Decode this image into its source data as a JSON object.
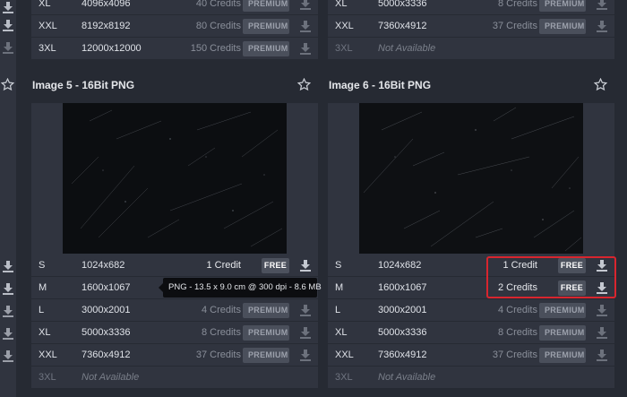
{
  "left_strip": {
    "icon": "download-icon"
  },
  "image5": {
    "title": "Image 5 - 16Bit PNG",
    "top_rows": [
      {
        "size": "XL",
        "dim": "4096x4096",
        "credits": "40 Credits",
        "badge": "PREMIUM"
      },
      {
        "size": "XXL",
        "dim": "8192x8192",
        "credits": "80 Credits",
        "badge": "PREMIUM"
      },
      {
        "size": "3XL",
        "dim": "12000x12000",
        "credits": "150 Credits",
        "badge": "PREMIUM"
      }
    ],
    "rows": [
      {
        "size": "S",
        "dim": "1024x682",
        "credits": "1 Credit",
        "badge": "FREE"
      },
      {
        "size": "M",
        "dim": "1600x1067",
        "credits": "",
        "badge": ""
      },
      {
        "size": "L",
        "dim": "3000x2001",
        "credits": "4 Credits",
        "badge": "PREMIUM"
      },
      {
        "size": "XL",
        "dim": "5000x3336",
        "credits": "8 Credits",
        "badge": "PREMIUM"
      },
      {
        "size": "XXL",
        "dim": "7360x4912",
        "credits": "37 Credits",
        "badge": "PREMIUM"
      },
      {
        "size": "3XL",
        "dim": "Not Available",
        "credits": "",
        "badge": ""
      }
    ],
    "tooltip": "PNG - 13.5 x 9.0 cm @ 300 dpi - 8.6 MB"
  },
  "image6": {
    "title": "Image 6 - 16Bit PNG",
    "top_rows": [
      {
        "size": "XL",
        "dim": "5000x3336",
        "credits": "8 Credits",
        "badge": "PREMIUM"
      },
      {
        "size": "XXL",
        "dim": "7360x4912",
        "credits": "37 Credits",
        "badge": "PREMIUM"
      },
      {
        "size": "3XL",
        "dim": "Not Available",
        "credits": "",
        "badge": ""
      }
    ],
    "rows": [
      {
        "size": "S",
        "dim": "1024x682",
        "credits": "1 Credit",
        "badge": "FREE"
      },
      {
        "size": "M",
        "dim": "1600x1067",
        "credits": "2 Credits",
        "badge": "FREE"
      },
      {
        "size": "L",
        "dim": "3000x2001",
        "credits": "4 Credits",
        "badge": "PREMIUM"
      },
      {
        "size": "XL",
        "dim": "5000x3336",
        "credits": "8 Credits",
        "badge": "PREMIUM"
      },
      {
        "size": "XXL",
        "dim": "7360x4912",
        "credits": "37 Credits",
        "badge": "PREMIUM"
      },
      {
        "size": "3XL",
        "dim": "Not Available",
        "credits": "",
        "badge": ""
      }
    ]
  },
  "colors": {
    "background": "#262a33",
    "panel": "#30343f",
    "highlight": "#d8252e"
  }
}
